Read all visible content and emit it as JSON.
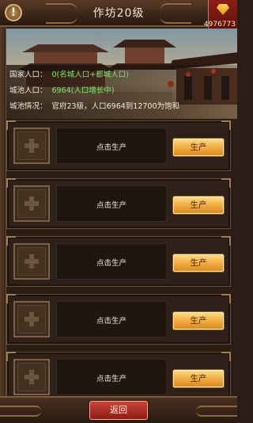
{
  "header": {
    "title": "作坊20级",
    "info_icon": "exclamation-icon",
    "currency": {
      "icon": "gem-icon",
      "value": "4976773"
    }
  },
  "stats": [
    {
      "label": "国家人口：",
      "value": "0(名城人口+都城人口)",
      "color": "#7ee26a"
    },
    {
      "label": "城池人口：",
      "value": "6964(人口增长中)",
      "color": "#7ee26a"
    },
    {
      "label": "城池情况：",
      "value": "官府23级，人口6964到12700为饱和",
      "color": "#f1e8d6"
    }
  ],
  "slots": [
    {
      "message": "点击生产",
      "button": "生产"
    },
    {
      "message": "点击生产",
      "button": "生产"
    },
    {
      "message": "点击生产",
      "button": "生产"
    },
    {
      "message": "点击生产",
      "button": "生产"
    },
    {
      "message": "点击生产",
      "button": "生产"
    }
  ],
  "footer": {
    "back_label": "返回"
  }
}
